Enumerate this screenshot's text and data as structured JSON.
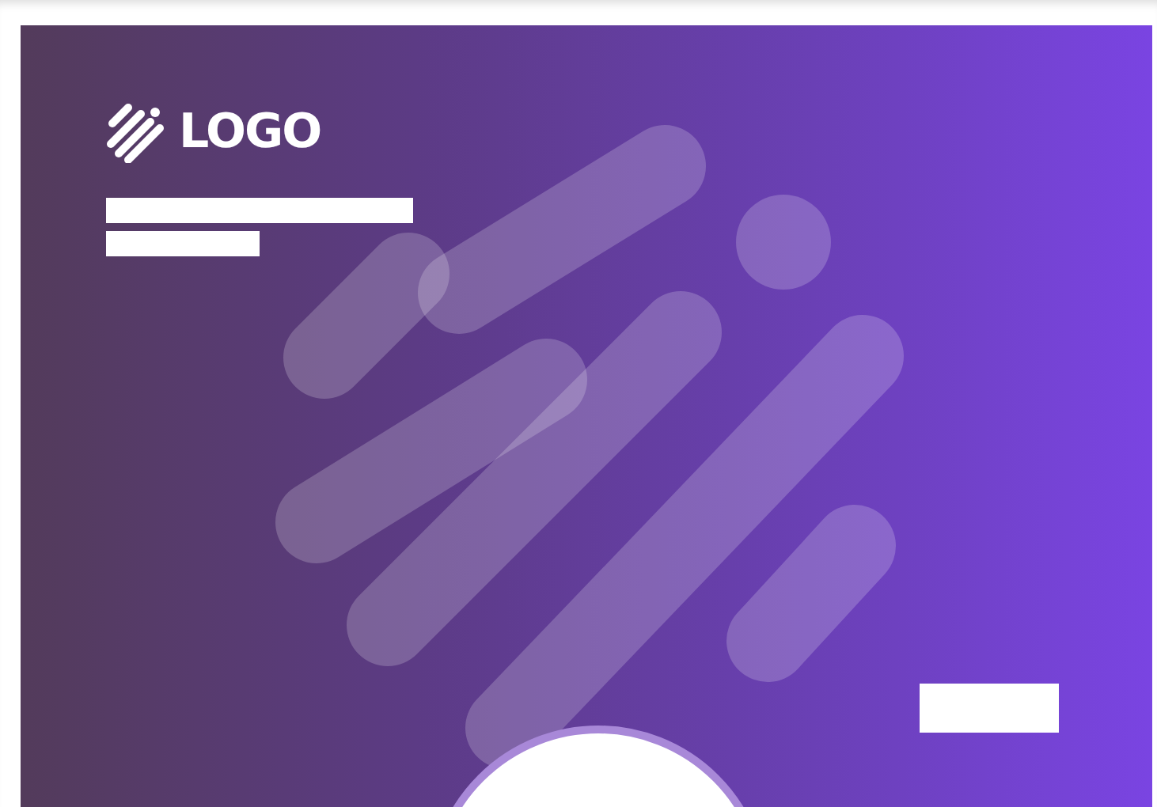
{
  "logo": {
    "text": "LOGO"
  }
}
